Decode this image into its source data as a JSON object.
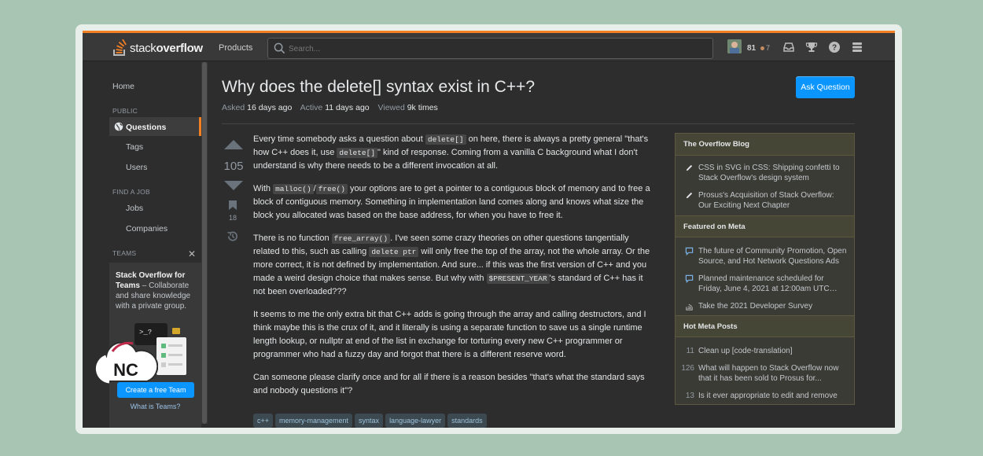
{
  "header": {
    "logo_light": "stack",
    "logo_bold": "overflow",
    "products": "Products",
    "search_placeholder": "Search...",
    "reputation": "81",
    "bronze": "7"
  },
  "leftnav": {
    "home": "Home",
    "public": "PUBLIC",
    "questions": "Questions",
    "tags": "Tags",
    "users": "Users",
    "find_a_job": "FIND A JOB",
    "jobs": "Jobs",
    "companies": "Companies",
    "teams": "TEAMS",
    "teams_close": "✕",
    "teams_card_title": "Stack Overflow for Teams",
    "teams_card_text": " – Collaborate and share knowledge with a private group.",
    "create_team": "Create a free Team",
    "what_is_teams": "What is Teams?",
    "badge_text": "NC"
  },
  "question": {
    "title": "Why does the delete[] syntax exist in C++?",
    "asked_label": "Asked",
    "asked": "16 days ago",
    "active_label": "Active",
    "active": "11 days ago",
    "viewed_label": "Viewed",
    "viewed": "9k times",
    "ask_button": "Ask Question",
    "votes": "105",
    "bookmarks": "18",
    "p1_a": "Every time somebody asks a question about ",
    "p1_code1": "delete[]",
    "p1_b": " on here, there is always a pretty general \"that's how C++ does it, use ",
    "p1_code2": "delete[]",
    "p1_c": "\" kind of response. Coming from a vanilla C background what I don't understand is why there needs to be a different invocation at all.",
    "p2_a": "With ",
    "p2_code1": "malloc()",
    "p2_sep": "/",
    "p2_code2": "free()",
    "p2_b": " your options are to get a pointer to a contiguous block of memory and to free a block of contiguous memory. Something in implementation land comes along and knows what size the block you allocated was based on the base address, for when you have to free it.",
    "p3_a": "There is no function ",
    "p3_code1": "free_array()",
    "p3_b": ". I've seen some crazy theories on other questions tangentially related to this, such as calling ",
    "p3_code2": "delete ptr",
    "p3_c": " will only free the top of the array, not the whole array. Or the more correct, it is not defined by implementation. And sure... if this was the first version of C++ and you made a weird design choice that makes sense. But why with ",
    "p3_code3": "$PRESENT_YEAR",
    "p3_d": "'s standard of C++ has it not been overloaded???",
    "p4": "It seems to me the only extra bit that C++ adds is going through the array and calling destructors, and I think maybe this is the crux of it, and it literally is using a separate function to save us a single runtime length lookup, or nullptr at end of the list in exchange for torturing every new C++ programmer or programmer who had a fuzzy day and forgot that there is a different reserve word.",
    "p5": "Can someone please clarify once and for all if there is a reason besides \"that's what the standard says and nobody questions it\"?",
    "tags": [
      "c++",
      "memory-management",
      "syntax",
      "language-lawyer",
      "standards"
    ]
  },
  "sidebar": {
    "blog_title": "The Overflow Blog",
    "blog_items": [
      "CSS in SVG in CSS: Shipping confetti to Stack Overflow's design system",
      "Prosus's Acquisition of Stack Overflow: Our Exciting Next Chapter"
    ],
    "meta_title": "Featured on Meta",
    "meta_items": [
      "The future of Community Promotion, Open Source, and Hot Network Questions Ads",
      "Planned maintenance scheduled for Friday, June 4, 2021 at 12:00am UTC…",
      "Take the 2021 Developer Survey"
    ],
    "hot_title": "Hot Meta Posts",
    "hot_items": [
      {
        "count": "11",
        "text": "Clean up [code-translation]"
      },
      {
        "count": "126",
        "text": "What will happen to Stack Overflow now that it has been sold to Prosus for..."
      },
      {
        "count": "13",
        "text": "Is it ever appropriate to edit and remove"
      }
    ]
  },
  "colors": {
    "accent": "#f48024",
    "button": "#0a95ff",
    "background": "#2d2d2d"
  }
}
